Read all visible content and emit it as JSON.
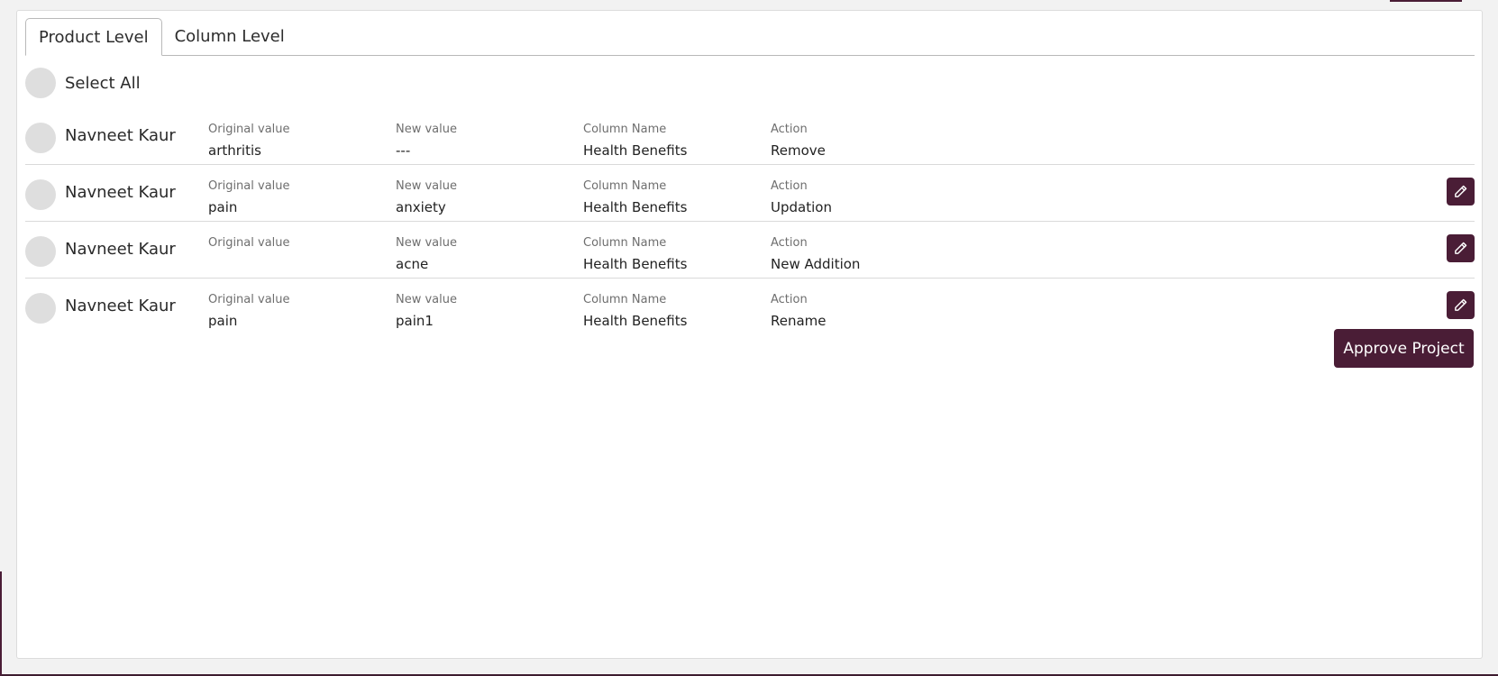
{
  "tabs": [
    {
      "label": "Product Level",
      "active": true
    },
    {
      "label": "Column Level",
      "active": false
    }
  ],
  "select_all_label": "Select All",
  "rows": [
    {
      "user": "Navneet Kaur",
      "original_label": "Original value",
      "original_value": "arthritis",
      "new_label": "New value",
      "new_value": "---",
      "column_label": "Column Name",
      "column_value": "Health Benefits",
      "action_label": "Action",
      "action_value": "Remove",
      "editable": false
    },
    {
      "user": "Navneet Kaur",
      "original_label": "Original value",
      "original_value": "pain",
      "new_label": "New value",
      "new_value": "anxiety",
      "column_label": "Column Name",
      "column_value": "Health Benefits",
      "action_label": "Action",
      "action_value": "Updation",
      "editable": true
    },
    {
      "user": "Navneet Kaur",
      "original_label": "Original value",
      "original_value": "",
      "new_label": "New value",
      "new_value": "acne",
      "column_label": "Column Name",
      "column_value": "Health Benefits",
      "action_label": "Action",
      "action_value": "New Addition",
      "editable": true
    },
    {
      "user": "Navneet Kaur",
      "original_label": "Original value",
      "original_value": "pain",
      "new_label": "New value",
      "new_value": "pain1",
      "column_label": "Column Name",
      "column_value": "Health Benefits",
      "action_label": "Action",
      "action_value": "Rename",
      "editable": true
    }
  ],
  "approve_label": "Approve Project",
  "icons": {
    "edit": "pencil-icon"
  },
  "colors": {
    "accent": "#4a1d36",
    "radio": "#dedede",
    "background": "#f2f2f2"
  }
}
